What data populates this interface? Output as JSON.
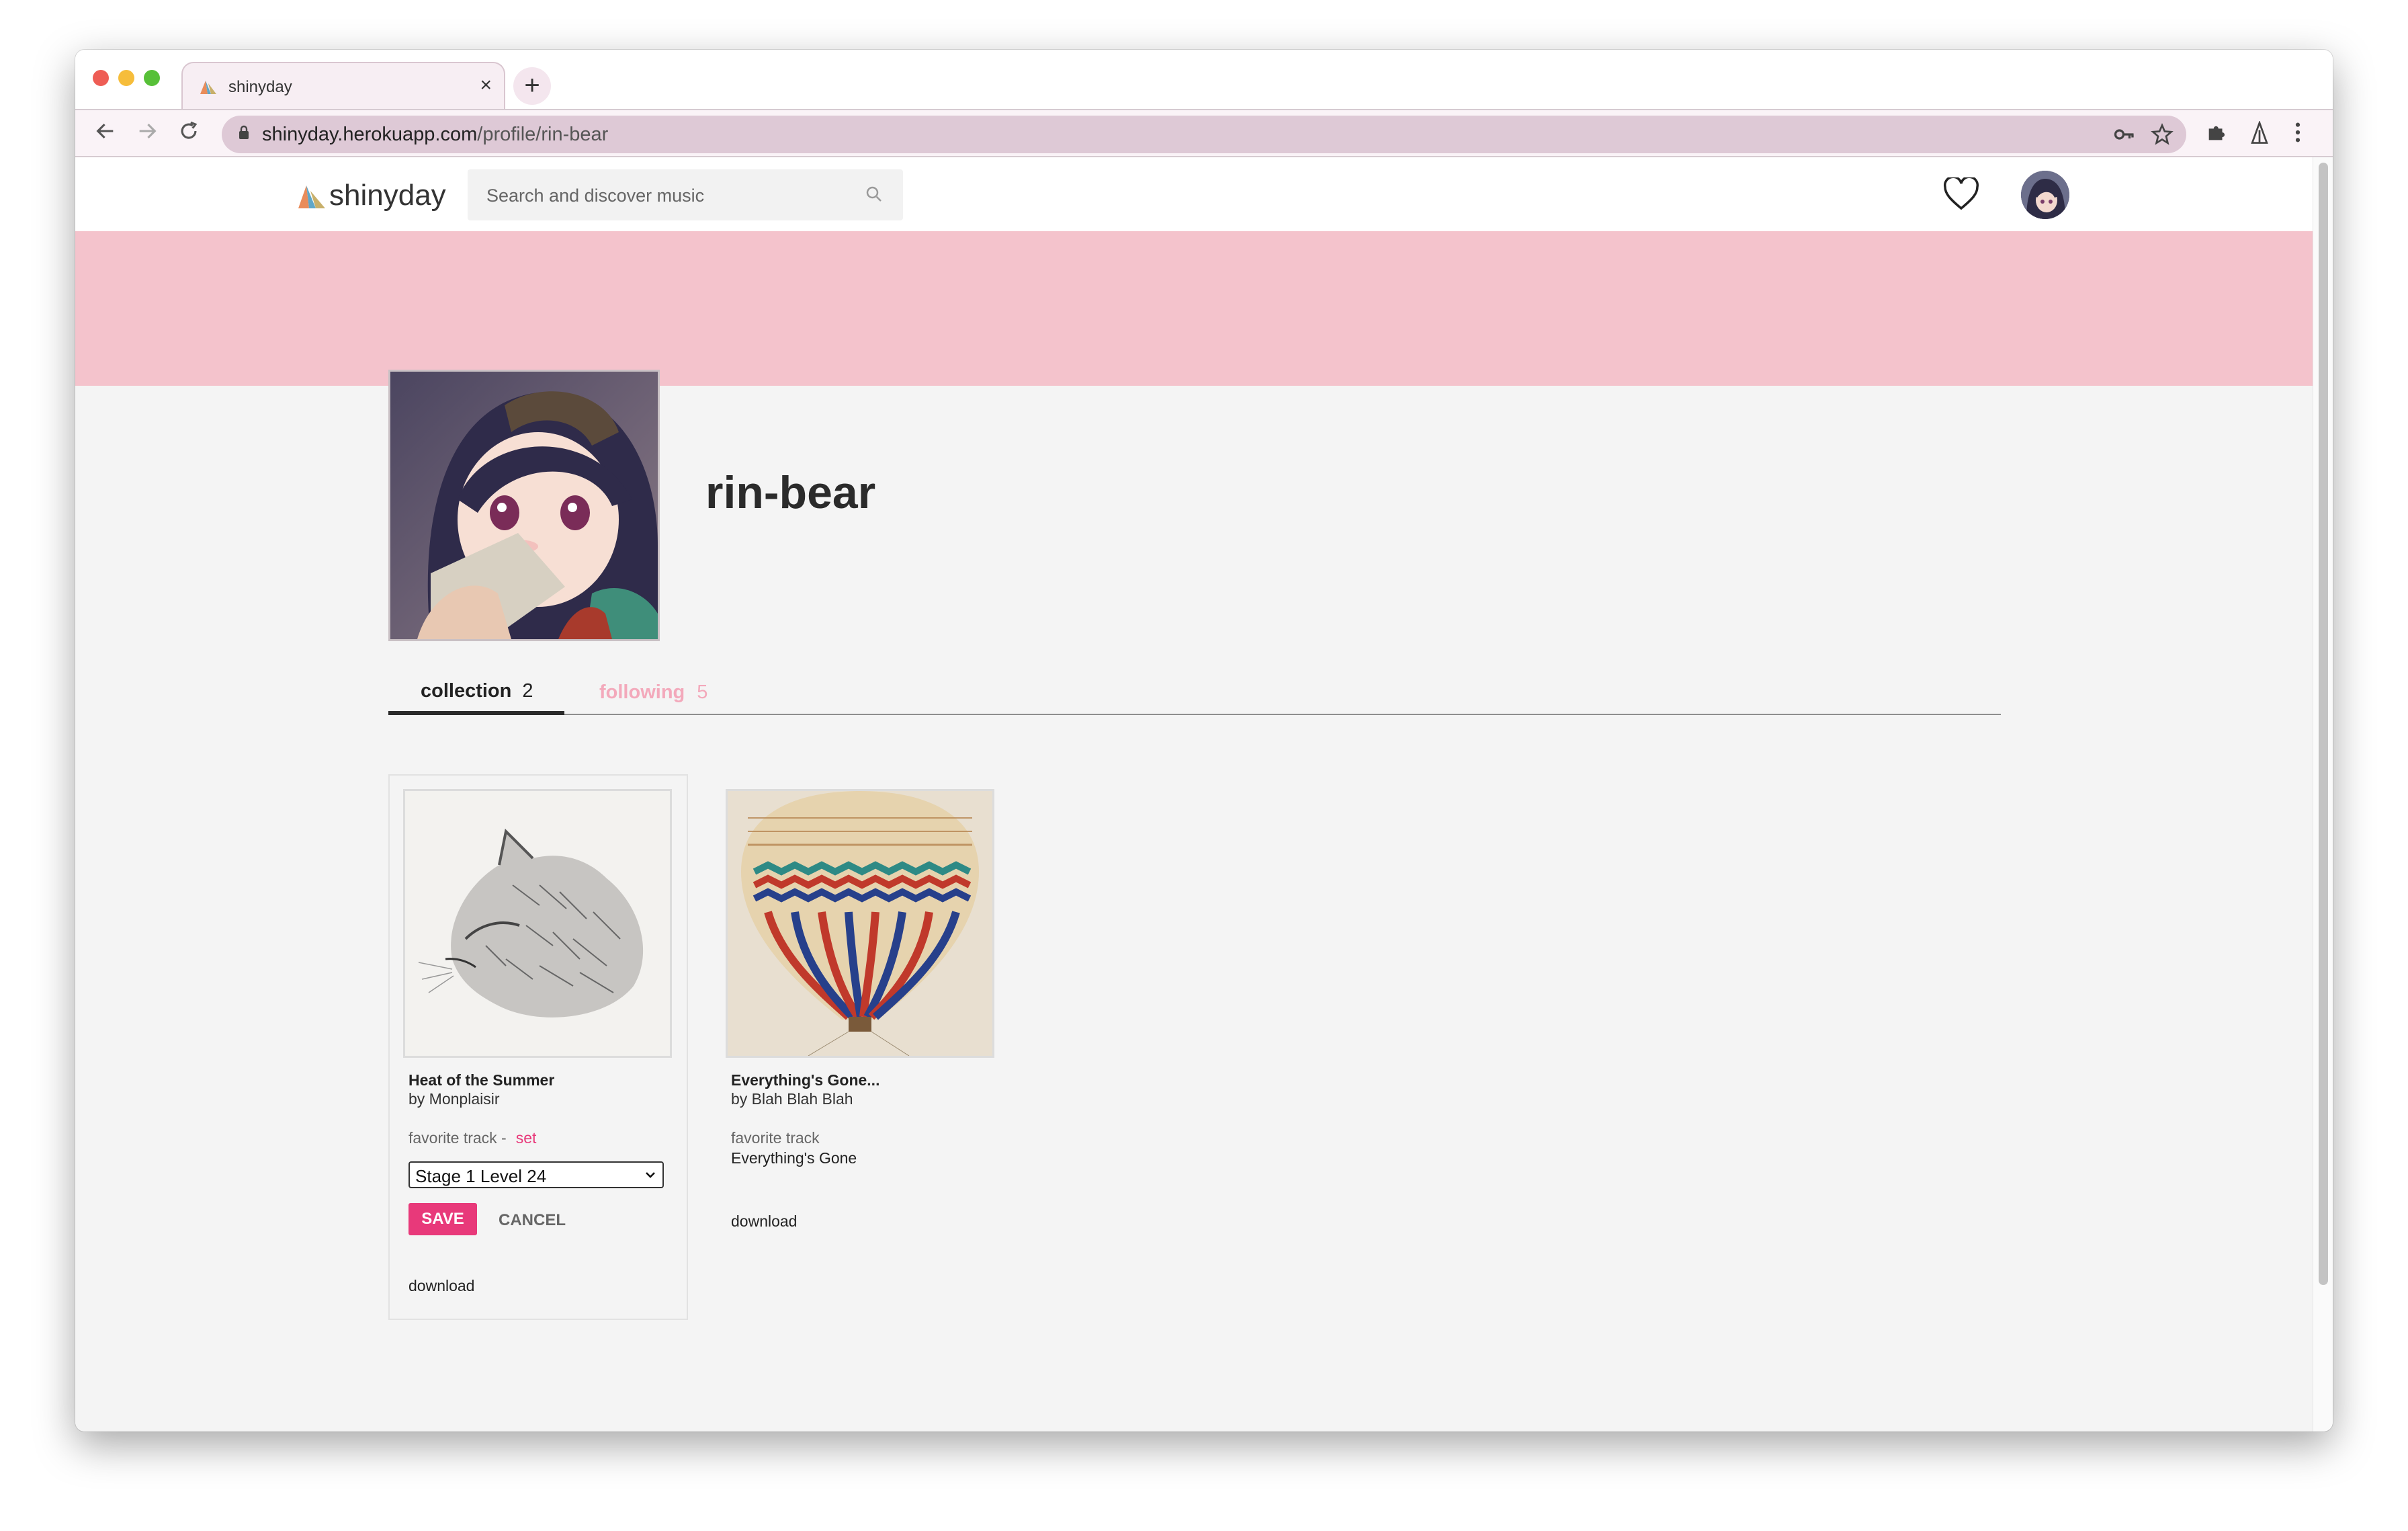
{
  "browser": {
    "tab_title": "shinyday",
    "tab_close": "×",
    "new_tab": "+",
    "url_host": "shinyday.herokuapp.com",
    "url_path": "/profile/rin-bear",
    "icons": [
      "back-icon",
      "forward-icon",
      "reload-icon",
      "lock-icon",
      "key-icon",
      "star-icon",
      "extensions-icon",
      "extension-icon",
      "menu-icon"
    ]
  },
  "header": {
    "logo_text": "shinyday",
    "search_placeholder": "Search and discover music"
  },
  "profile": {
    "username": "rin-bear"
  },
  "tabs": {
    "collection_label": "collection",
    "collection_count": "2",
    "following_label": "following",
    "following_count": "5"
  },
  "collection": [
    {
      "title": "Heat of the Summer",
      "artist": "by Monplaisir",
      "favorite_label": "favorite track -",
      "favorite_action": "set",
      "select_value": "Stage 1 Level 24",
      "save_label": "SAVE",
      "cancel_label": "CANCEL",
      "download_label": "download"
    },
    {
      "title": "Everything's Gone...",
      "artist": "by Blah Blah Blah",
      "favorite_label": "favorite track",
      "favorite_value": "Everything's Gone",
      "download_label": "download"
    }
  ],
  "colors": {
    "banner": "#f4c3cc",
    "accent": "#e8397a",
    "following_tab": "#f3a9bb"
  }
}
